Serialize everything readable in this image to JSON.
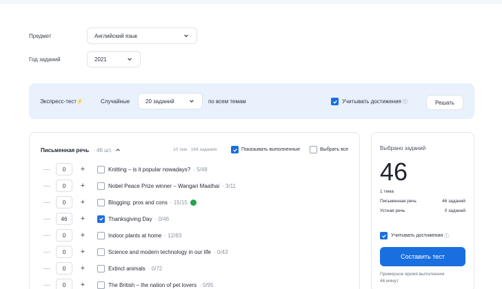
{
  "filters": {
    "subject_label": "Предмет",
    "subject_value": "Английский язык",
    "year_label": "Год заданий",
    "year_value": "2021"
  },
  "express": {
    "title": "Экспресс-тест",
    "bolt_icon": "lightning-icon",
    "random_label": "Случайные",
    "count_value": "20 заданий",
    "topics_label": "по всем темам",
    "achievements_label": "Учитывать достижения",
    "info_icon": "info-icon",
    "solve_label": "Решать"
  },
  "tasks_panel": {
    "section_title": "Письменная речь",
    "section_count": "· 46 шт.",
    "stats": "10 тем · 164 задания",
    "show_done_label": "Показывать выполненные",
    "select_all_label": "Выбрать все",
    "items": [
      {
        "qty": "0",
        "title": "Knitting – is it popular nowadays?",
        "meta": "· 5/48",
        "checked": false,
        "done": false
      },
      {
        "qty": "0",
        "title": "Nobel Peace Prize winner – Wangari Maathai",
        "meta": "· 3/11",
        "checked": false,
        "done": false
      },
      {
        "qty": "0",
        "title": "Blogging: pros and cons",
        "meta": "· 15/15",
        "checked": false,
        "done": true
      },
      {
        "qty": "46",
        "title": "Thanksgiving Day",
        "meta": "· 0/46",
        "checked": true,
        "done": false
      },
      {
        "qty": "0",
        "title": "Indoor plants at home",
        "meta": "· 12/83",
        "checked": false,
        "done": false
      },
      {
        "qty": "0",
        "title": "Science and modern technology in our life",
        "meta": "· 0/43",
        "checked": false,
        "done": false
      },
      {
        "qty": "0",
        "title": "Extinct animals",
        "meta": "· 0/72",
        "checked": false,
        "done": false
      },
      {
        "qty": "0",
        "title": "The British – the nation of pet lovers",
        "meta": "· 0/95",
        "checked": false,
        "done": false
      }
    ]
  },
  "summary": {
    "title": "Выбрано заданий",
    "total": "46",
    "topics": "1 тема",
    "rows": [
      {
        "label": "Письменная речь",
        "value": "46 заданий"
      },
      {
        "label": "Устная речь",
        "value": "0 заданий"
      }
    ],
    "achievements_label": "Учитывать достижения",
    "build_label": "Составить тест",
    "time_line1": "Примерное время выполнения",
    "time_line2": "46 минут"
  },
  "colors": {
    "accent": "#1a6fe0",
    "done": "#22a54b",
    "express_bg": "#e8f1fc"
  }
}
